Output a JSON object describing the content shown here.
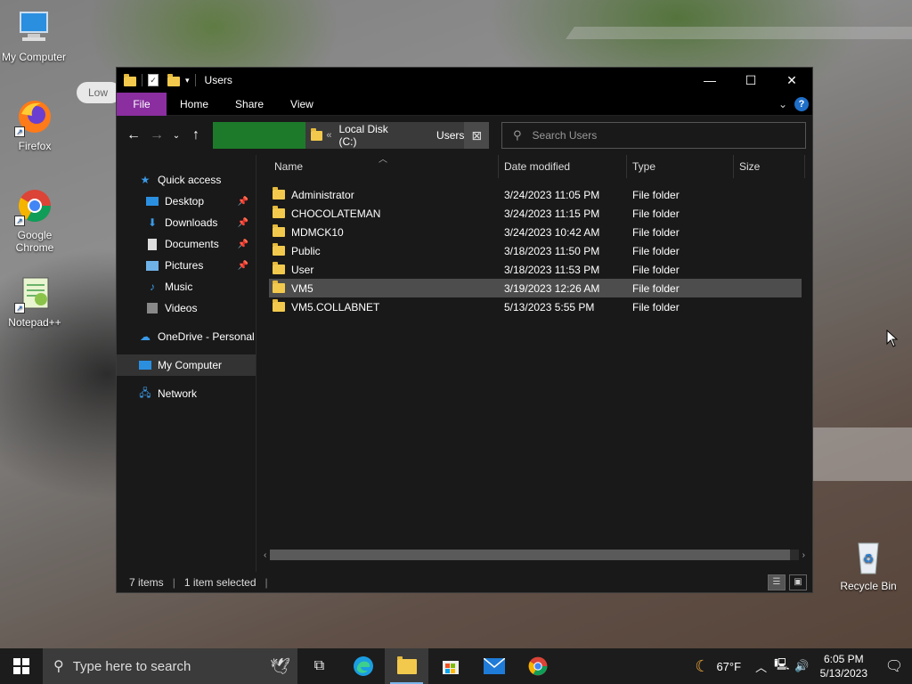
{
  "desktop": {
    "icons": [
      {
        "label": "My Computer",
        "icon": "computer-icon"
      },
      {
        "label": "Firefox",
        "icon": "firefox-icon"
      },
      {
        "label": "Google Chrome",
        "icon": "chrome-icon"
      },
      {
        "label": "Notepad++",
        "icon": "notepadpp-icon"
      },
      {
        "label": "Recycle Bin",
        "icon": "recycle-bin-icon"
      }
    ],
    "bubble": "Low"
  },
  "window": {
    "title": "Users",
    "ribbon_tabs": [
      "File",
      "Home",
      "Share",
      "View"
    ],
    "help": "?",
    "breadcrumb": [
      "Local Disk (C:)",
      "Users"
    ],
    "search_placeholder": "Search Users",
    "nav": {
      "quick_access": "Quick access",
      "pinned": [
        "Desktop",
        "Downloads",
        "Documents",
        "Pictures"
      ],
      "unpinned": [
        "Music",
        "Videos"
      ],
      "onedrive": "OneDrive - Personal",
      "my_computer": "My Computer",
      "network": "Network"
    },
    "columns": [
      "Name",
      "Date modified",
      "Type",
      "Size"
    ],
    "files": [
      {
        "name": "Administrator",
        "date": "3/24/2023 11:05 PM",
        "type": "File folder"
      },
      {
        "name": "CHOCOLATEMAN",
        "date": "3/24/2023 11:15 PM",
        "type": "File folder"
      },
      {
        "name": "MDMCK10",
        "date": "3/24/2023 10:42 AM",
        "type": "File folder"
      },
      {
        "name": "Public",
        "date": "3/18/2023 11:50 PM",
        "type": "File folder"
      },
      {
        "name": "User",
        "date": "3/18/2023 11:53 PM",
        "type": "File folder"
      },
      {
        "name": "VM5",
        "date": "3/19/2023 12:26 AM",
        "type": "File folder"
      },
      {
        "name": "VM5.COLLABNET",
        "date": "5/13/2023 5:55 PM",
        "type": "File folder"
      }
    ],
    "selected_index": 5,
    "status": {
      "items": "7 items",
      "selected": "1 item selected"
    }
  },
  "taskbar": {
    "search_placeholder": "Type here to search",
    "weather": "67°F",
    "time": "6:05 PM",
    "date": "5/13/2023"
  },
  "colors": {
    "accent_file_tab": "#8a2ea0",
    "breadcrumb_green": "#1d7a2a",
    "selection": "#4d4d4d"
  }
}
